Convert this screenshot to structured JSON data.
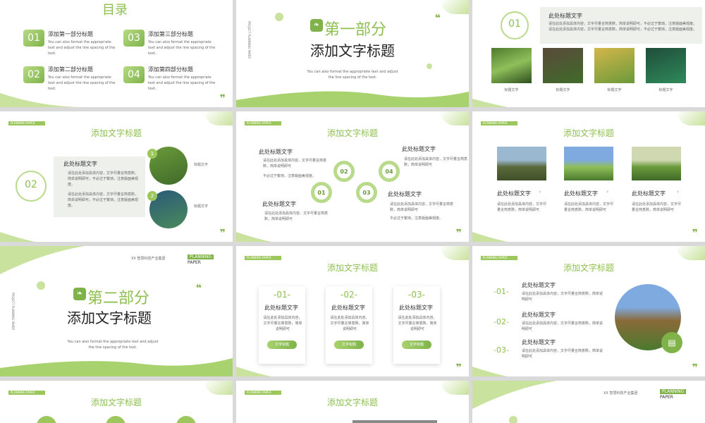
{
  "s1": {
    "title": "目录",
    "items": [
      {
        "num": "01",
        "title": "添加第一部分标题",
        "desc": "You can also format the appropriate text and adjust the line spacing of the text."
      },
      {
        "num": "02",
        "title": "添加第二部分标题",
        "desc": "You can also format the appropriate text and adjust the line spacing of the text."
      },
      {
        "num": "03",
        "title": "添加第三部分标题",
        "desc": "You can also format the appropriate text and adjust the line spacing of the text."
      },
      {
        "num": "04",
        "title": "添加第四部分标题",
        "desc": "You can also format the appropriate text and adjust the line spacing of the text."
      }
    ]
  },
  "s2": {
    "part": "第一部分",
    "title": "添加文字标题",
    "desc": "You can also format the appropriate text and adjust the line spacing of the text.",
    "vertical": "PROJECT PLANNING PAPER"
  },
  "s3": {
    "num": "01",
    "heading": "此处标题文字",
    "text": "请在此处添加具体内容，文字尽量言简意赅，简单说明即可，不必过于繁琐，注意版面美观度。请在此处添加具体内容，文字尽量言简意赅，简单说明即可，不必过于繁琐，注意版面美观度。",
    "captions": [
      "标题文字",
      "标题文字",
      "标题文字",
      "标题文字"
    ]
  },
  "s4": {
    "tag": "PLANNING PAPER",
    "title": "添加文字标题",
    "num": "02",
    "heading": "此处标题文字",
    "bullets": [
      "请在此处添加具体内容，文字尽量言简意赅，简单说明即可，不必过于繁琐，注意版面美观度。",
      "请在此处添加具体内容，文字尽量言简意赅，简单说明即可，不必过于繁琐，注意版面美观度。"
    ],
    "items": [
      {
        "n": "1",
        "label": "标题文字"
      },
      {
        "n": "2",
        "label": "标题文字"
      }
    ]
  },
  "s5": {
    "tag": "PLANNING PAPER",
    "title": "添加文字标题",
    "blocks": [
      {
        "heading": "此处标题文字",
        "lines": [
          "请在此处添加具体内容，文字尽量言简意赅，简单说明即可",
          "不必过于繁琐，注意版面美观度。"
        ]
      },
      {
        "heading": "此处标题文字",
        "lines": [
          "请在此处添加具体内容，文字尽量言简意赅，简单说明即可"
        ]
      },
      {
        "heading": "此处标题文字",
        "lines": [
          "请在此处添加具体内容，文字尽量言简意赅，简单说明即可"
        ]
      },
      {
        "heading": "此处标题文字",
        "lines": [
          "请在此处添加具体内容，文字尽量言简意赅，简单说明即可",
          "不必过于繁琐，注意版面美观度。"
        ]
      }
    ],
    "nums": [
      "01",
      "02",
      "03",
      "04"
    ]
  },
  "s6": {
    "tag": "PLANNING PAPER",
    "title": "添加文字标题",
    "cols": [
      {
        "heading": "此处标题文字",
        "text": "请在此处添加具体内容，文字尽量言简意赅，简单说明即可"
      },
      {
        "heading": "此处标题文字",
        "text": "请在此处添加具体内容，文字尽量言简意赅，简单说明即可"
      },
      {
        "heading": "此处标题文字",
        "text": "请在此处添加具体内容，文字尽量言简意赅，简单说明即可"
      }
    ]
  },
  "s7": {
    "company": "XX 智慧科技产业集团",
    "brand1": "PLANNING",
    "brand2": "PAPER",
    "part": "第二部分",
    "title": "添加文字标题",
    "desc": "You can also format the appropriate text and adjust the line spacing of the text.",
    "vertical": "PROJECT PLANNING PAPER"
  },
  "s8": {
    "tag": "PLANNING PAPER",
    "title": "添加文字标题",
    "cards": [
      {
        "num": "-01-",
        "heading": "此处标题文字",
        "text": "请在此处添加具体内容，文字尽量言简意赅，简单说明即可",
        "btn": "文字标题"
      },
      {
        "num": "-02-",
        "heading": "此处标题文字",
        "text": "请在此处添加具体内容，文字尽量言简意赅，简单说明即可",
        "btn": "文字标题"
      },
      {
        "num": "-03-",
        "heading": "此处标题文字",
        "text": "请在此处添加具体内容，文字尽量言简意赅，简单说明即可",
        "btn": "文字标题"
      }
    ]
  },
  "s9": {
    "tag": "PLANNING PAPER",
    "title": "添加文字标题",
    "rows": [
      {
        "num": "-01-",
        "heading": "此处标题文字",
        "text": "请在此处添加具体内容，文字尽量言简意赅，简单说明即可"
      },
      {
        "num": "-02-",
        "heading": "此处标题文字",
        "text": "请在此处添加具体内容，文字尽量言简意赅，简单说明即可"
      },
      {
        "num": "-03-",
        "heading": "此处标题文字",
        "text": "请在此处添加具体内容，文字尽量言简意赅，简单说明即可"
      }
    ]
  },
  "s10": {
    "tag": "PLANNING PAPER",
    "title": "添加文字标题"
  },
  "s11": {
    "tag": "PLANNING PAPER",
    "title": "添加文字标题"
  },
  "s12": {
    "company": "XX 智慧科技产业集团",
    "brand1": "PLANNING",
    "brand2": "PAPER"
  },
  "colors": {
    "accent": "#7fb34a",
    "light": "#c9e29d"
  }
}
